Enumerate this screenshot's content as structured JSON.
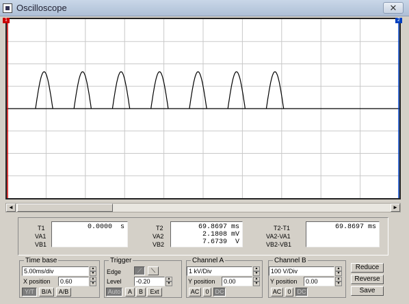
{
  "window": {
    "title": "Oscilloscope",
    "close_glyph": "✕",
    "icon": "oscilloscope-app-icon"
  },
  "markers": {
    "cursor1": "1",
    "cursor2": "2"
  },
  "colors": {
    "trace": "#000000",
    "grid": "#c8c8c8",
    "cursor1": "#cc0000",
    "cursor2": "#0040c0",
    "screen_bg": "#ffffff"
  },
  "chart_data": {
    "type": "line",
    "title": "",
    "xlabel": "",
    "ylabel": "",
    "grid": true,
    "divisions": {
      "x": 10,
      "y": 8
    },
    "series": [
      {
        "shape": "half-sine-peaks",
        "peak_count": 7,
        "period_div": 0.98,
        "first_peak_center_div": 0.95,
        "peak_width_div": 0.44,
        "amplitude_div": 1.65,
        "baseline_div": 0
      }
    ],
    "cursor_x_div": [
      0,
      10
    ]
  },
  "scroll": {
    "left_arrow": "◄",
    "right_arrow": "►"
  },
  "readouts": {
    "t1": {
      "label": "T1",
      "value": "0.0000",
      "unit": "s"
    },
    "va1": {
      "label": "VA1",
      "value": "",
      "unit": ""
    },
    "vb1": {
      "label": "VB1",
      "value": "",
      "unit": ""
    },
    "t2": {
      "label": "T2",
      "value": "69.8697",
      "unit": "ms"
    },
    "va2": {
      "label": "VA2",
      "value": "2.1808",
      "unit": "mV"
    },
    "vb2": {
      "label": "VB2",
      "value": "7.6739",
      "unit": "V"
    },
    "t21": {
      "label": "T2-T1",
      "value": "69.8697",
      "unit": "ms"
    },
    "va21": {
      "label": "VA2-VA1",
      "value": "",
      "unit": ""
    },
    "vb21": {
      "label": "VB2-VB1",
      "value": "",
      "unit": ""
    }
  },
  "timebase": {
    "title": "Time base",
    "scale": "5.00ms/div",
    "xpos_label": "X position",
    "xpos": "0.60",
    "buttons": [
      "Y/T",
      "B/A",
      "A/B"
    ],
    "active": "Y/T"
  },
  "trigger": {
    "title": "Trigger",
    "edge_label": "Edge",
    "edge_rising": "⟋",
    "edge_falling": "⟍",
    "level_label": "Level",
    "level": "-0.20",
    "buttons": [
      "Auto",
      "A",
      "B",
      "Ext"
    ]
  },
  "channel_a": {
    "title": "Channel A",
    "scale": "1 kV/Div",
    "ypos_label": "Y position",
    "ypos": "0.00",
    "coupling": [
      "AC",
      "0",
      "DC"
    ],
    "active": "DC"
  },
  "channel_b": {
    "title": "Channel B",
    "scale": "100 V/Div",
    "ypos_label": "Y position",
    "ypos": "0.00",
    "coupling": [
      "AC",
      "0",
      "DC"
    ],
    "active": "DC"
  },
  "actions": {
    "reduce": "Reduce",
    "reverse": "Reverse",
    "save": "Save"
  }
}
